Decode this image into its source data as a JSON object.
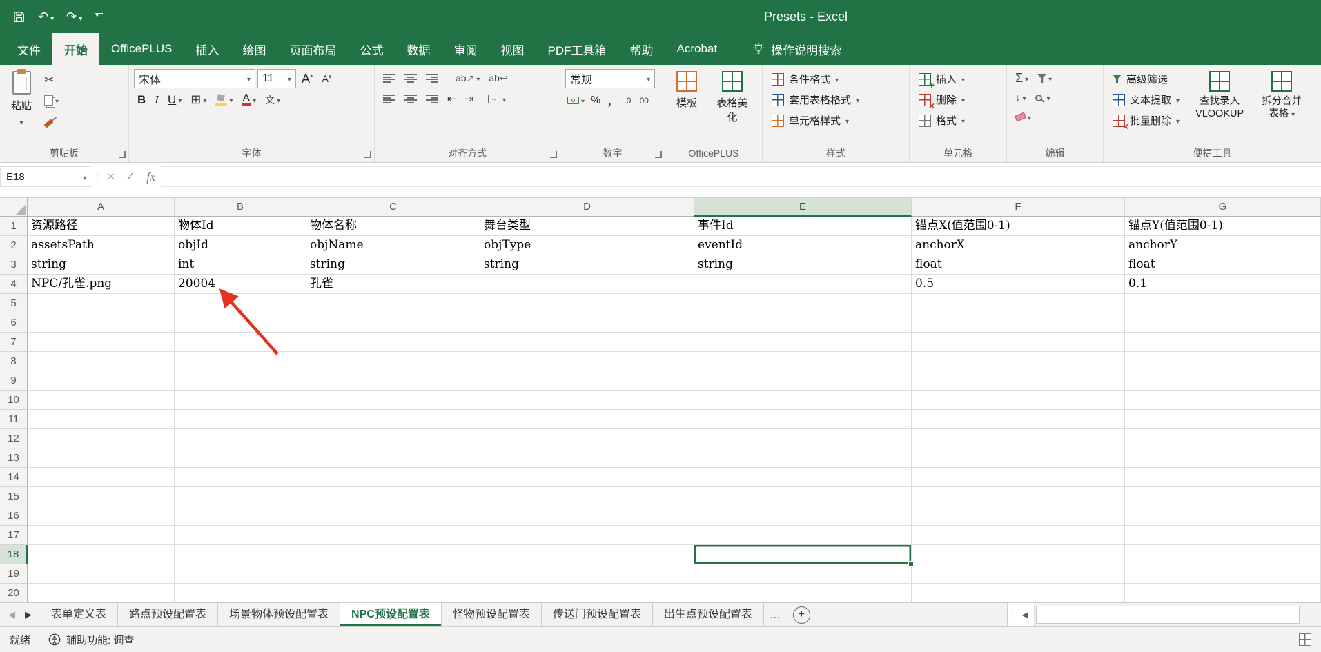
{
  "titlebar": {
    "title": "Presets  -  Excel"
  },
  "tabbar": {
    "tabs": [
      {
        "id": "file",
        "label": "文件",
        "file": true
      },
      {
        "id": "home",
        "label": "开始",
        "active": true
      },
      {
        "id": "officeplus",
        "label": "OfficePLUS"
      },
      {
        "id": "insert",
        "label": "插入"
      },
      {
        "id": "draw",
        "label": "绘图"
      },
      {
        "id": "page-layout",
        "label": "页面布局"
      },
      {
        "id": "formulas",
        "label": "公式"
      },
      {
        "id": "data",
        "label": "数据"
      },
      {
        "id": "review",
        "label": "审阅"
      },
      {
        "id": "view",
        "label": "视图"
      },
      {
        "id": "pdf-toolbox",
        "label": "PDF工具箱"
      },
      {
        "id": "help",
        "label": "帮助"
      },
      {
        "id": "acrobat",
        "label": "Acrobat"
      }
    ],
    "search_label": "操作说明搜索"
  },
  "ribbon": {
    "clipboard": {
      "label": "剪贴板",
      "paste": "粘贴"
    },
    "font": {
      "label": "字体",
      "font_name": "宋体",
      "font_size": "11",
      "bold": "B",
      "italic": "I",
      "underline": "U",
      "phonetic": "文",
      "color_letter": "A",
      "size_letter": "A"
    },
    "alignment": {
      "label": "对齐方式",
      "orientation": "ab",
      "wrap": "ab"
    },
    "number": {
      "label": "数字",
      "format": "常规",
      "percent": "%",
      "comma": "，",
      "dec_increase": ".0",
      "dec_decrease": ".00"
    },
    "officeplus": {
      "label": "OfficePLUS",
      "template": "模板",
      "beautify": "表格美化"
    },
    "styles": {
      "label": "样式",
      "conditional": "条件格式",
      "format_table": "套用表格格式",
      "cell_styles": "单元格样式"
    },
    "cells": {
      "label": "单元格",
      "insert": "插入",
      "delete": "删除",
      "format": "格式"
    },
    "editing": {
      "label": "编辑",
      "autosum": "Σ"
    },
    "tools": {
      "label": "便捷工具",
      "advanced_filter": "高级筛选",
      "text_extract": "文本提取",
      "batch_delete": "批量删除",
      "vlookup_line1": "查找录入",
      "vlookup_line2": "VLOOKUP",
      "split_line1": "拆分合并",
      "split_line2": "表格"
    }
  },
  "formula_bar": {
    "name_box": "E18",
    "cancel": "×",
    "enter": "✓",
    "fx": "fx",
    "content": ""
  },
  "grid": {
    "column_headers": [
      "A",
      "B",
      "C",
      "D",
      "E",
      "F",
      "G"
    ],
    "total_rows": 20,
    "data_rows": [
      [
        "资源路径",
        "物体Id",
        "物体名称",
        "舞台类型",
        "事件Id",
        "锚点X(值范围0-1)",
        "锚点Y(值范围0-1)"
      ],
      [
        "assetsPath",
        "objId",
        "objName",
        "objType",
        "eventId",
        "anchorX",
        "anchorY"
      ],
      [
        "string",
        "int",
        "string",
        "string",
        "string",
        "float",
        "float"
      ],
      [
        "NPC/孔雀.png",
        "20004",
        "孔雀",
        "",
        "",
        "0.5",
        "0.1"
      ]
    ],
    "selected_cell": "E18",
    "selected_column": "E",
    "selected_row": 18
  },
  "sheet_bar": {
    "nav_prev": "◀",
    "nav_next": "▶",
    "tabs": [
      {
        "label": "表单定义表"
      },
      {
        "label": "路点预设配置表"
      },
      {
        "label": "场景物体预设配置表"
      },
      {
        "label": "NPC预设配置表",
        "active": true
      },
      {
        "label": "怪物预设配置表"
      },
      {
        "label": "传送门预设配置表"
      },
      {
        "label": "出生点预设配置表"
      }
    ],
    "overflow": "…",
    "add": "+",
    "scroll_left": "◀",
    "grip": "⋮"
  },
  "status_bar": {
    "ready": "就绪",
    "accessibility": "辅助功能: 调查"
  },
  "colors": {
    "accent_green": "#217346",
    "arrow_red": "#e8301f",
    "selection_header": "#d6e2d6"
  }
}
